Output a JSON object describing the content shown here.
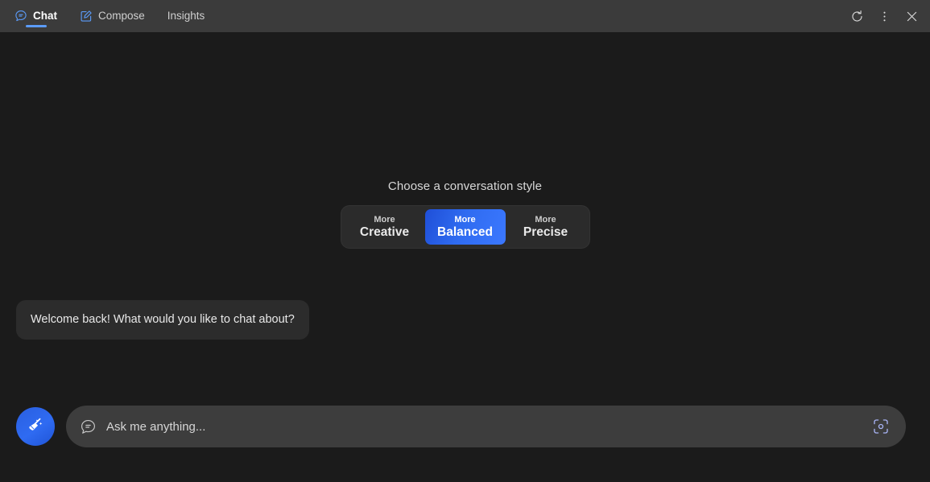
{
  "app": {
    "background_color": "#1b1b1b",
    "topbar_color": "#3b3b3b",
    "accent_color": "#3b78ff"
  },
  "topbar": {
    "tabs": [
      {
        "label": "Chat",
        "icon": "chat-bubble-icon",
        "active": true
      },
      {
        "label": "Compose",
        "icon": "compose-pencil-icon",
        "active": false
      },
      {
        "label": "Insights",
        "icon": "",
        "active": false
      }
    ],
    "window_controls": [
      {
        "name": "refresh-button",
        "icon": "refresh-icon"
      },
      {
        "name": "more-options-button",
        "icon": "kebab-menu-icon"
      },
      {
        "name": "close-button",
        "icon": "close-icon"
      }
    ]
  },
  "conversation_style": {
    "title": "Choose a conversation style",
    "selected": "Balanced",
    "options": [
      {
        "top": "More",
        "bottom": "Creative",
        "selected": false
      },
      {
        "top": "More",
        "bottom": "Balanced",
        "selected": true
      },
      {
        "top": "More",
        "bottom": "Precise",
        "selected": false
      }
    ]
  },
  "messages": [
    {
      "sender": "assistant",
      "text": "Welcome back! What would you like to chat about?"
    }
  ],
  "composer": {
    "new_topic_label": "New topic",
    "new_topic_icon": "broom-sweep-icon",
    "chat_icon": "chat-bubble-icon",
    "input_value": "",
    "placeholder": "Ask me anything...",
    "visual_search_icon": "visual-search-scan-icon"
  }
}
